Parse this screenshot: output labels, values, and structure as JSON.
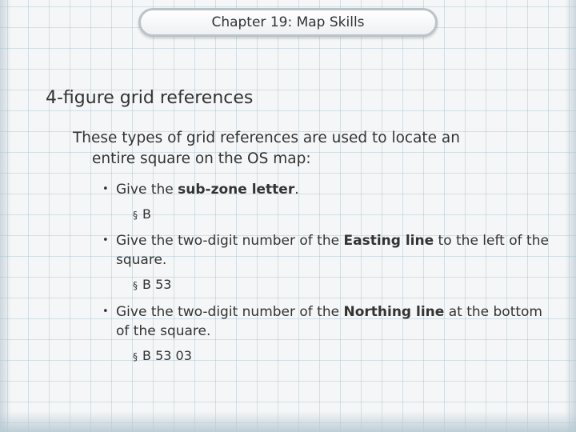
{
  "slide": {
    "title": "Chapter 19: Map Skills",
    "heading": "4-figure grid references",
    "intro_line1": "These types of grid references are used to locate an",
    "intro_line2": "entire square on the OS map:",
    "bullet_marker": "•",
    "sub_marker": "§",
    "bullets": [
      {
        "before": "Give the ",
        "bold": "sub-zone letter",
        "after": ".",
        "sub": "B"
      },
      {
        "before": "Give the two-digit number of the ",
        "bold": "Easting line",
        "after": " to the left of the square.",
        "sub": "B 53"
      },
      {
        "before": "Give the two-digit number of the ",
        "bold": "Northing line",
        "after": " at the bottom of the square.",
        "sub": "B 53 03"
      }
    ]
  }
}
